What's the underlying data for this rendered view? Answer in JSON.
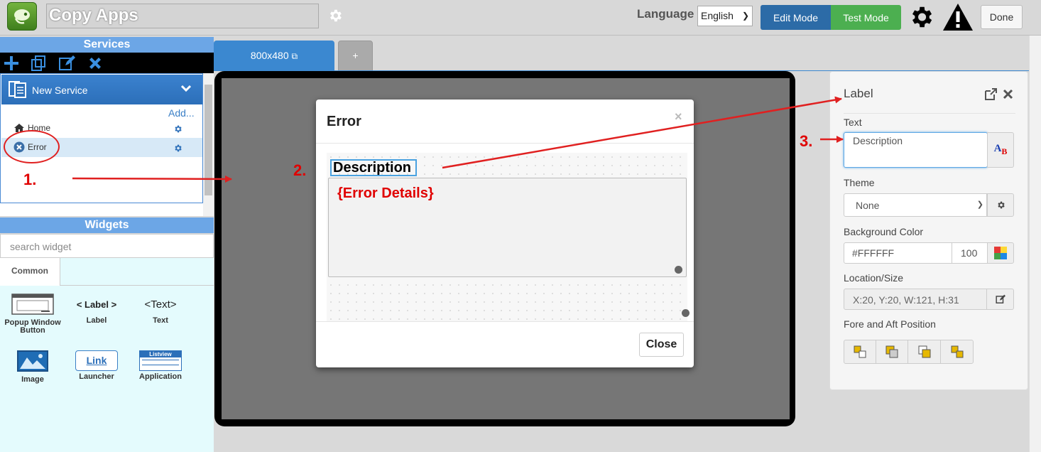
{
  "header": {
    "app_title": "Copy Apps",
    "language_label": "Language",
    "language_value": "English",
    "edit_mode": "Edit Mode",
    "test_mode": "Test Mode",
    "done": "Done"
  },
  "sidebar": {
    "services_heading": "Services",
    "service_name": "New Service",
    "add_label": "Add...",
    "items": [
      {
        "label": "Home",
        "icon": "home-icon"
      },
      {
        "label": "Error",
        "icon": "close-circle-icon",
        "selected": true
      }
    ],
    "widgets_heading": "Widgets",
    "search_placeholder": "search widget",
    "tab_label": "Common",
    "widgets": [
      {
        "label": "Popup Window Button",
        "icon": "popup-window-icon"
      },
      {
        "label": "Label",
        "preview": "< Label >"
      },
      {
        "label": "Text",
        "preview": "<Text>"
      },
      {
        "label": "Image",
        "icon": "image-icon"
      },
      {
        "label": "Launcher",
        "preview": "Link"
      },
      {
        "label": "Application",
        "preview": "Listview"
      }
    ]
  },
  "canvas": {
    "tab_label": "800x480",
    "add_tab": "+"
  },
  "dialog": {
    "title": "Error",
    "close_x": "×",
    "description_label": "Description",
    "details_text": "{Error Details}",
    "close_button": "Close"
  },
  "properties": {
    "title": "Label",
    "text_label": "Text",
    "text_value": "Description",
    "theme_label": "Theme",
    "theme_value": "None",
    "bg_label": "Background Color",
    "bg_value": "#FFFFFF",
    "opacity_value": "100",
    "location_label": "Location/Size",
    "location_value": "X:20, Y:20, W:121, H:31",
    "fore_aft_label": "Fore and Aft Position"
  },
  "annotations": {
    "step1": "1.",
    "step2": "2.",
    "step3": "3."
  },
  "colors": {
    "accent_blue": "#2c6ba7",
    "test_green": "#4caf50",
    "annotation_red": "#e00000",
    "panel_head": "#6ca6e6"
  }
}
